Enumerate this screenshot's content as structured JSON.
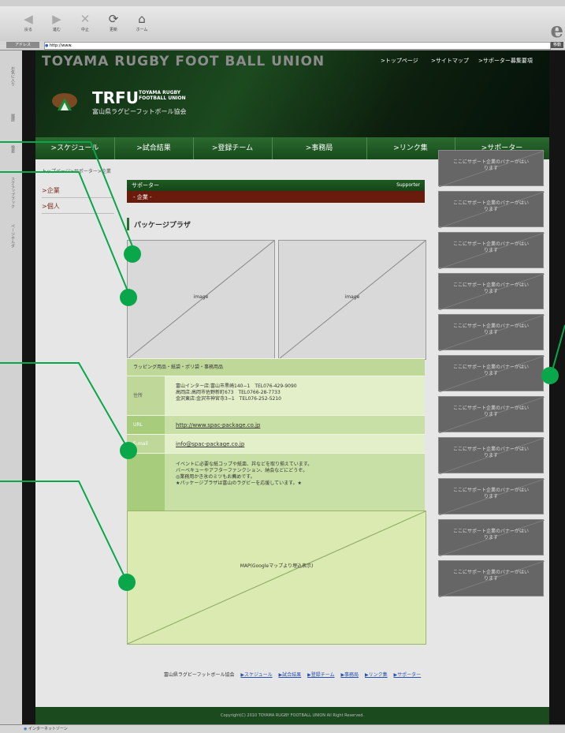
{
  "browser": {
    "toolbar_buttons": [
      {
        "glyph": "◀",
        "label": "戻る",
        "dim": true
      },
      {
        "glyph": "▶",
        "label": "進む",
        "dim": true
      },
      {
        "glyph": "✕",
        "label": "中止",
        "dim": true
      },
      {
        "glyph": "⟳",
        "label": "更新",
        "dim": false
      },
      {
        "glyph": "⌂",
        "label": "ホーム",
        "dim": false
      }
    ],
    "address_label": "アドレス",
    "address_value": "http://www.",
    "go_label": "移動",
    "ie_logo": "e",
    "explorer_tabs": [
      "お気に入り",
      "履歴",
      "検索",
      "スクラップブック",
      "ページホルダ"
    ],
    "status_text": "インターネットゾーン"
  },
  "site": {
    "title": "TOYAMA RUGBY FOOT BALL UNION",
    "top_links": [
      ">トップページ",
      ">サイトマップ",
      ">サポーター募集要項"
    ],
    "logo": {
      "abbr": "TRFU",
      "eng": "TOYAMA RUGBY FOOTBALL UNION",
      "jp": "富山県ラグビーフットボール協会"
    },
    "nav": [
      ">スケジュール",
      ">試合結果",
      ">登録チーム",
      ">事務局",
      ">リンク集",
      ">サポーター"
    ],
    "breadcrumb": "トップページ>サポーター>企業",
    "sidebar": [
      ">企業",
      ">個人"
    ],
    "panel": {
      "label": "サポーター",
      "label_en": "Supporter",
      "sub": "- 企業 -"
    },
    "shop_title": "パッケージプラザ",
    "images": [
      "image",
      "image"
    ],
    "info": {
      "category": "ラッピング用品・紙袋・ポリ袋・事務用品",
      "address_label": "住所",
      "address_lines": [
        "富山インター店:富山市黒崎140−1　TEL076-429-9090",
        "高岡店:高岡市佐野新町673　TEL0766-28-7733",
        "金沢東店:金沢市神宮寺3−1　TEL076-252-5210"
      ],
      "url_label": "URL",
      "url_value": "http://www.spac-package.co.jp",
      "email_label": "E-mail",
      "email_value": "info@spac-package.co.jp",
      "desc_lines": [
        "イベントに必要な紙コップや紙皿、丼などを取り揃えています。",
        "バーベキューやアフターファンクション、納会などにどうぞ。",
        "◎業務用かき氷のミツもお薦めです。",
        "★パッケージプラザは富山のラグビーを応援しています。★"
      ]
    },
    "map_label": "MAP(Googleマップより埋込表示)",
    "banner_text": "ここにサポート企業のバナーがはいります",
    "banner_count": 11,
    "footer": {
      "org": "富山県ラグビーフットボール協会",
      "links": [
        "▶スケジュール",
        "▶試合結果",
        "▶登録チーム",
        "▶事務局",
        "▶リンク集",
        "▶サポーター"
      ],
      "copyright": "Copyright(C) 2010 TOYAMA RUGBY FOOTBALL UNION All Right Reserved."
    }
  },
  "colors": {
    "accent_green": "#1c4a1f",
    "callout": "#0aa64a",
    "subheader": "#6a1c0c",
    "banner": "#666666",
    "info_bg": "#cfe3a7"
  }
}
